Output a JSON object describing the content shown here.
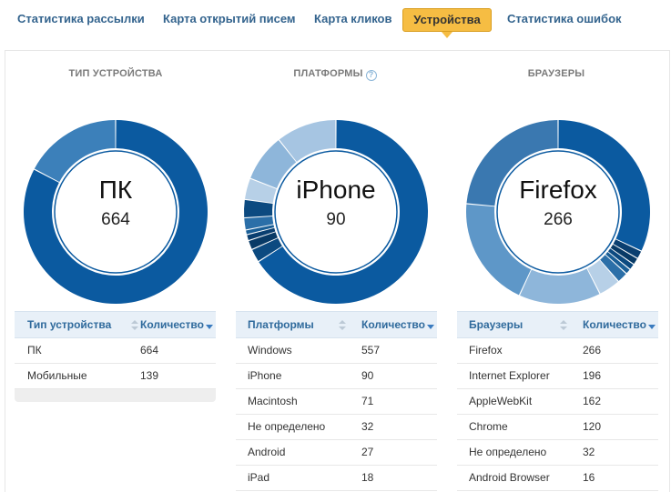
{
  "tabs": [
    {
      "label": "Статистика рассылки"
    },
    {
      "label": "Карта открытий писем"
    },
    {
      "label": "Карта кликов"
    },
    {
      "label": "Устройства"
    },
    {
      "label": "Статистика ошибок"
    }
  ],
  "active_tab": "Устройства",
  "colors": {
    "accent_tab": "#f6bd43",
    "header_text": "#2f6a9c",
    "donut_palette": [
      "#0b5aa0",
      "#3c80ba",
      "#5e97c8",
      "#8eb6da",
      "#b7d0e7",
      "#0c4a80",
      "#083a66",
      "#1a5f97",
      "#2b6fa8",
      "#0a3f70"
    ]
  },
  "columns": [
    {
      "title": "ТИП УСТРОЙСТВА",
      "has_help": false,
      "donut": {
        "center_name": "ПК",
        "center_value": "664",
        "segments": [
          {
            "label": "ПК",
            "value": 664,
            "color": "#0b5aa0",
            "highlight": true
          },
          {
            "label": "Мобильные",
            "value": 139,
            "color": "#3c80ba"
          }
        ]
      },
      "table": {
        "header_name": "Тип устройства",
        "header_count": "Количество",
        "rows": [
          {
            "name": "ПК",
            "count": "664"
          },
          {
            "name": "Мобильные",
            "count": "139"
          }
        ],
        "footer": true
      }
    },
    {
      "title": "ПЛАТФОРМЫ",
      "has_help": true,
      "help_icon": "question-circle-icon",
      "donut": {
        "center_name": "iPhone",
        "center_value": "90",
        "segments": [
          {
            "label": "Windows",
            "value": 557,
            "color": "#0b5aa0"
          },
          {
            "label": "seg-a",
            "value": 20,
            "color": "#0c4a80"
          },
          {
            "label": "seg-b",
            "value": 14,
            "color": "#083a66"
          },
          {
            "label": "seg-c",
            "value": 9,
            "color": "#0a3f70"
          },
          {
            "label": "seg-d",
            "value": 7,
            "color": "#1a5f97"
          },
          {
            "label": "iPad",
            "value": 18,
            "color": "#2b6fa8"
          },
          {
            "label": "Android",
            "value": 27,
            "color": "#0c4a80"
          },
          {
            "label": "Не определено",
            "value": 32,
            "color": "#b7d0e7"
          },
          {
            "label": "Macintosh",
            "value": 71,
            "color": "#8eb6da"
          },
          {
            "label": "iPhone",
            "value": 90,
            "color": "#a6c5e2",
            "highlight": true
          }
        ]
      },
      "table": {
        "header_name": "Платформы",
        "header_count": "Количество",
        "rows": [
          {
            "name": "Windows",
            "count": "557"
          },
          {
            "name": "iPhone",
            "count": "90"
          },
          {
            "name": "Macintosh",
            "count": "71"
          },
          {
            "name": "Не определено",
            "count": "32"
          },
          {
            "name": "Android",
            "count": "27"
          },
          {
            "name": "iPad",
            "count": "18"
          }
        ],
        "footer": false
      }
    },
    {
      "title": "БРАУЗЕРЫ",
      "has_help": false,
      "donut": {
        "center_name": "Firefox",
        "center_value": "266",
        "segments": [
          {
            "label": "Firefox",
            "value": 266,
            "color": "#0b5aa0",
            "highlight": true
          },
          {
            "label": "seg-a",
            "value": 12,
            "color": "#0a3f70"
          },
          {
            "label": "seg-b",
            "value": 10,
            "color": "#083a66"
          },
          {
            "label": "seg-c",
            "value": 9,
            "color": "#0c4a80"
          },
          {
            "label": "seg-d",
            "value": 8,
            "color": "#1a5f97"
          },
          {
            "label": "Android Browser",
            "value": 16,
            "color": "#2b6fa8"
          },
          {
            "label": "Не определено",
            "value": 32,
            "color": "#b7d0e7"
          },
          {
            "label": "Chrome",
            "value": 120,
            "color": "#8eb6da"
          },
          {
            "label": "AppleWebKit",
            "value": 162,
            "color": "#5e97c8"
          },
          {
            "label": "Internet Explorer",
            "value": 196,
            "color": "#3a78b0"
          }
        ]
      },
      "table": {
        "header_name": "Браузеры",
        "header_count": "Количество",
        "rows": [
          {
            "name": "Firefox",
            "count": "266"
          },
          {
            "name": "Internet Explorer",
            "count": "196"
          },
          {
            "name": "AppleWebKit",
            "count": "162"
          },
          {
            "name": "Chrome",
            "count": "120"
          },
          {
            "name": "Не определено",
            "count": "32"
          },
          {
            "name": "Android Browser",
            "count": "16"
          }
        ],
        "footer": false
      }
    }
  ]
}
